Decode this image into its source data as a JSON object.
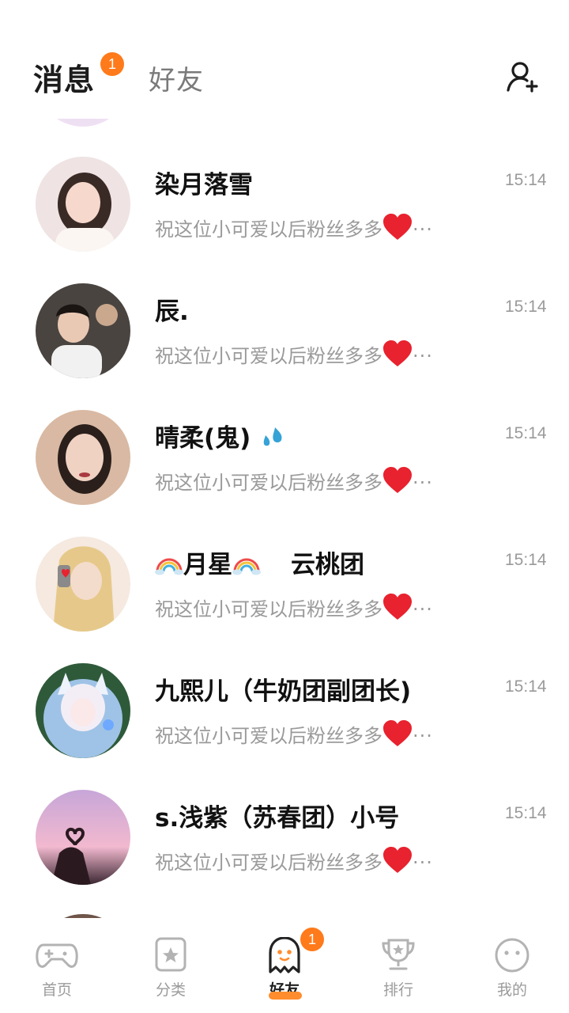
{
  "header": {
    "tab_messages": "消息",
    "tab_friends": "好友",
    "message_badge": "1",
    "add_friend_icon": "add-user-icon"
  },
  "conversations": [
    {
      "name": "染月落雪",
      "time": "15:14",
      "preview": "祝这位小可爱以后粉丝多多",
      "ellipsis": "···"
    },
    {
      "name": "辰.",
      "time": "15:14",
      "preview": "祝这位小可爱以后粉丝多多",
      "ellipsis": "···"
    },
    {
      "name": "晴柔(鬼)",
      "time": "15:14",
      "preview": "祝这位小可爱以后粉丝多多",
      "ellipsis": "···"
    },
    {
      "name": "月星",
      "name_suffix": "云桃团",
      "time": "15:14",
      "preview": "祝这位小可爱以后粉丝多多",
      "ellipsis": "···"
    },
    {
      "name": "九熙儿（牛奶团副团长)",
      "time": "15:14",
      "preview": "祝这位小可爱以后粉丝多多",
      "ellipsis": "···"
    },
    {
      "name": "s.浅紫（苏春团）小号",
      "time": "15:14",
      "preview": "祝这位小可爱以后粉丝多多",
      "ellipsis": "···"
    }
  ],
  "bottom_nav": {
    "items": [
      {
        "label": "首页",
        "icon": "gamepad-icon"
      },
      {
        "label": "分类",
        "icon": "star-box-icon"
      },
      {
        "label": "好友",
        "icon": "ghost-icon",
        "active": true,
        "badge": "1"
      },
      {
        "label": "排行",
        "icon": "trophy-icon"
      },
      {
        "label": "我的",
        "icon": "face-icon"
      }
    ]
  },
  "colors": {
    "accent": "#ff7a1a",
    "heart": "#e8222e",
    "text_secondary": "#9a9a9a"
  }
}
